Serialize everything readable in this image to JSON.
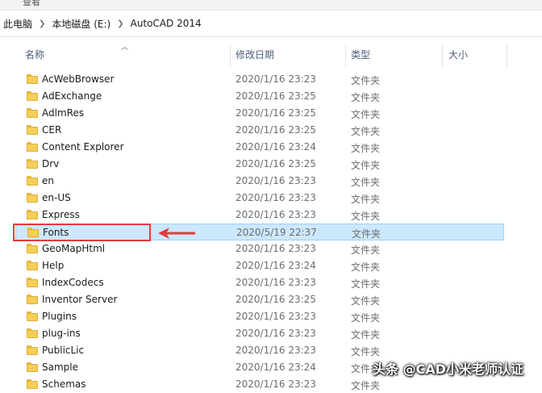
{
  "ribbon": {
    "label": "查看"
  },
  "breadcrumb": [
    {
      "label": "此电脑"
    },
    {
      "label": "本地磁盘 (E:)"
    },
    {
      "label": "AutoCAD 2014"
    }
  ],
  "columns": {
    "name": "名称",
    "date": "修改日期",
    "type": "类型",
    "size": "大小"
  },
  "rows": [
    {
      "name": "AcWebBrowser",
      "date": "2020/1/16 23:23",
      "type": "文件夹"
    },
    {
      "name": "AdExchange",
      "date": "2020/1/16 23:25",
      "type": "文件夹"
    },
    {
      "name": "AdlmRes",
      "date": "2020/1/16 23:25",
      "type": "文件夹"
    },
    {
      "name": "CER",
      "date": "2020/1/16 23:25",
      "type": "文件夹"
    },
    {
      "name": "Content Explorer",
      "date": "2020/1/16 23:24",
      "type": "文件夹"
    },
    {
      "name": "Drv",
      "date": "2020/1/16 23:25",
      "type": "文件夹"
    },
    {
      "name": "en",
      "date": "2020/1/16 23:23",
      "type": "文件夹"
    },
    {
      "name": "en-US",
      "date": "2020/1/16 23:23",
      "type": "文件夹"
    },
    {
      "name": "Express",
      "date": "2020/1/16 23:23",
      "type": "文件夹"
    },
    {
      "name": "Fonts",
      "date": "2020/5/19 22:37",
      "type": "文件夹",
      "selected": true
    },
    {
      "name": "GeoMapHtml",
      "date": "2020/1/16 23:23",
      "type": "文件夹"
    },
    {
      "name": "Help",
      "date": "2020/1/16 23:24",
      "type": "文件夹"
    },
    {
      "name": "IndexCodecs",
      "date": "2020/1/16 23:23",
      "type": "文件夹"
    },
    {
      "name": "Inventor Server",
      "date": "2020/1/16 23:25",
      "type": "文件夹"
    },
    {
      "name": "Plugins",
      "date": "2020/1/16 23:23",
      "type": "文件夹"
    },
    {
      "name": "plug-ins",
      "date": "2020/1/16 23:23",
      "type": "文件夹"
    },
    {
      "name": "PublicLic",
      "date": "2020/1/16 23:23",
      "type": "文件夹"
    },
    {
      "name": "Sample",
      "date": "2020/1/16 23:24",
      "type": "文件夹"
    },
    {
      "name": "Schemas",
      "date": "2020/1/16 23:23",
      "type": "文件夹"
    }
  ],
  "watermark": "头条 @CAD小米老师认证",
  "colors": {
    "selection": "#cce8ff",
    "annotation": "#e23b3b",
    "folder": "#f7cf58"
  }
}
